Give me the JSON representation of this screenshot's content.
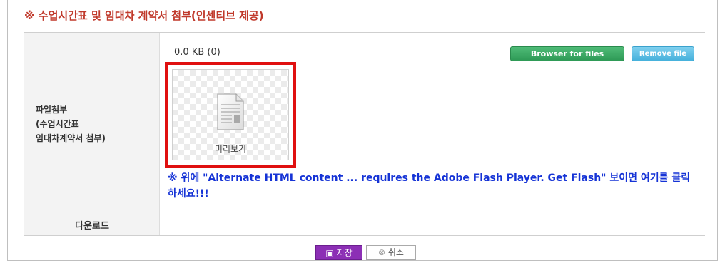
{
  "section": {
    "title": "※ 수업시간표 및 임대차 계약서 첨부(인센티브 제공)"
  },
  "attach_row": {
    "label_line1": "파일첨부",
    "label_line2": "(수업시간표",
    "label_line3": "임대차계약서 첨부)",
    "file_size": "0.0 KB (0)",
    "browse_label": "Browser for files",
    "remove_label": "Remove file",
    "preview_label": "미리보기",
    "notice": "※ 위에 \"Alternate HTML content ... requires the Adobe Flash Player. Get Flash\" 보이면 여기를 클릭 하세요!!!"
  },
  "download_row": {
    "label": "다운로드"
  },
  "actions": {
    "save_label": "저장",
    "cancel_label": "취소"
  },
  "colors": {
    "title": "#c0392b",
    "notice": "#1533d6",
    "save": "#8c2fb5",
    "browse": "#2e9a56",
    "remove": "#46b1dc",
    "highlight": "#e01010"
  },
  "icons": {
    "document": "document-icon",
    "save": "floppy-icon",
    "cancel": "x-mark-icon"
  }
}
